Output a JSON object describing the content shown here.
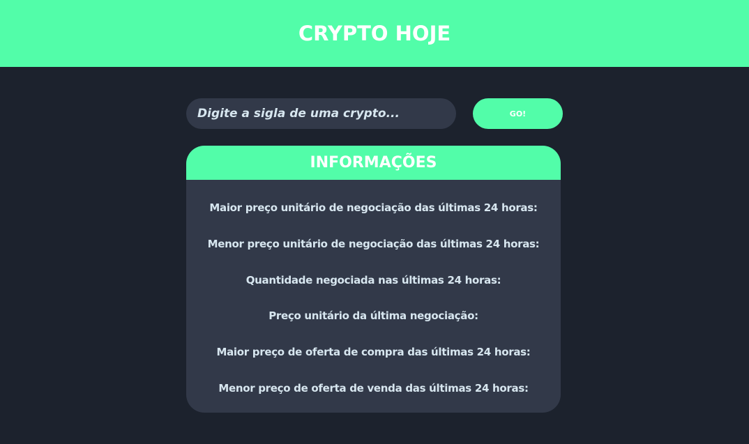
{
  "header": {
    "title": "CRYPTO HOJE"
  },
  "search": {
    "placeholder": "Digite a sigla de uma crypto...",
    "value": "",
    "button_label": "GO!"
  },
  "info": {
    "title": "INFORMAÇÕES",
    "items": [
      "Maior preço unitário de negociação das últimas 24 horas:",
      "Menor preço unitário de negociação das últimas 24 horas:",
      "Quantidade negociada nas últimas 24 horas:",
      "Preço unitário da última negociação:",
      "Maior preço de oferta de compra das últimas 24 horas:",
      "Menor preço de oferta de venda das últimas 24 horas:"
    ]
  },
  "colors": {
    "accent": "#52fda9",
    "background": "#1c222d",
    "card": "#323949",
    "text": "#d7e6ef"
  }
}
